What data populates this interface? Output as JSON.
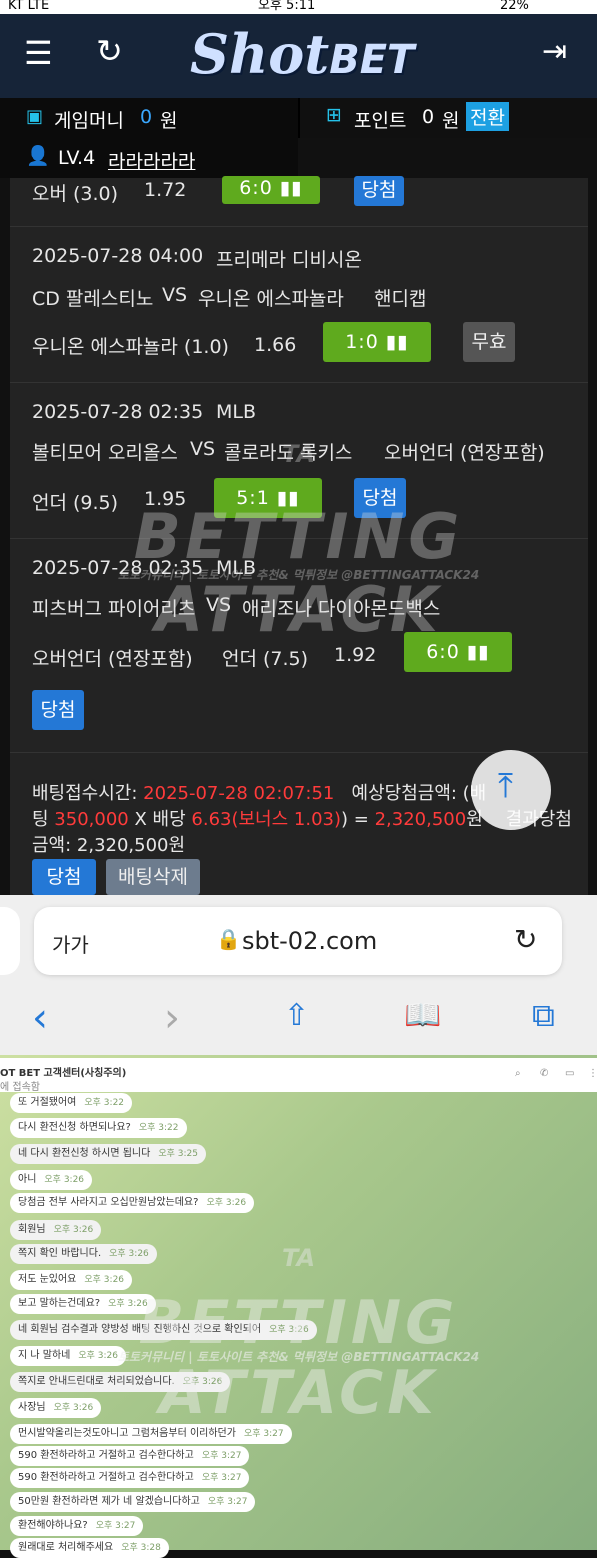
{
  "status": {
    "carrier": "KT LTE",
    "time": "오후 5:11",
    "battery": "22%"
  },
  "header": {
    "logo_script": "Shot",
    "logo_bet": "BET"
  },
  "wallet": {
    "money_label": "게임머니",
    "money_value": "0",
    "money_unit": "원",
    "point_label": "포인트",
    "point_value": "0",
    "point_unit": "원",
    "convert_label": "전환",
    "level": "LV.4",
    "nickname": "라라라라라"
  },
  "bets": {
    "partial": {
      "pick": "오버 (3.0)",
      "odds": "1.72",
      "score": "6:0",
      "result": "당첨"
    },
    "b1": {
      "datetime": "2025-07-28 04:00",
      "league": "프리메라 디비시온",
      "home": "CD 팔레스티노",
      "vs": "VS",
      "away": "우니온 에스파뇰라",
      "type": "핸디캡",
      "pick": "우니온 에스파뇰라 (1.0)",
      "odds": "1.66",
      "score": "1:0",
      "result": "무효"
    },
    "b2": {
      "datetime": "2025-07-28 02:35",
      "league": "MLB",
      "home": "볼티모어 오리올스",
      "vs": "VS",
      "away": "콜로라도 록키스",
      "type": "오버언더 (연장포함)",
      "pick": "언더 (9.5)",
      "odds": "1.95",
      "score": "5:1",
      "result": "당첨"
    },
    "b3": {
      "datetime": "2025-07-28 02:35",
      "league": "MLB",
      "home": "피츠버그 파이어리츠",
      "vs": "VS",
      "away": "애리조나 다이아몬드백스",
      "type": "오버언더 (연장포함)",
      "pick": "언더 (7.5)",
      "odds": "1.92",
      "score": "6:0",
      "result": "당첨"
    }
  },
  "summary": {
    "time_label": "배팅접수시간:",
    "time_value": "2025-07-28 02:07:51",
    "expected_label": "예상당첨금액: (배",
    "l2a": "팅",
    "stake": "350,000",
    "l2b": "X 배당",
    "odds": "6.63(보너스 1.03)",
    "l2c": ")",
    "eq": "=",
    "payout": "2,320,500",
    "unit": "원",
    "result_label": "결과당첨",
    "l3": "금액: 2,320,500원",
    "win_button": "당첨",
    "delete_button": "배팅삭제"
  },
  "browser": {
    "text_size": "가가",
    "url": "sbt-02.com"
  },
  "watermark": {
    "title": "BETTING ATTACK",
    "badge": "TA",
    "sub": "토토커뮤니티 | 토토사이트 추천& 먹튀정보 @BETTINGATTACK24"
  },
  "chat": {
    "title": "OT BET 고객센터(사칭주의)",
    "subtitle": "에 접속함",
    "messages": [
      {
        "text": "또 거절됐어여",
        "time": "오후 3:22"
      },
      {
        "text": "다시 환전신청 하면되나요?",
        "time": "오후 3:22"
      },
      {
        "text": "네 다시 환전신청 하시면 됩니다",
        "time": "오후 3:25"
      },
      {
        "text": "아니",
        "time": "오후 3:26"
      },
      {
        "text": "당첨금 전부 사라지고 오십만원남았는데요?",
        "time": "오후 3:26"
      },
      {
        "text": "회원님",
        "time": "오후 3:26"
      },
      {
        "text": "쪽지 확인 바랍니다.",
        "time": "오후 3:26"
      },
      {
        "text": "저도 눈있어요",
        "time": "오후 3:26"
      },
      {
        "text": "보고 말하는건데요?",
        "time": "오후 3:26"
      },
      {
        "text": "네 회원님 검수결과 양방성 배팅 진행하신 것으로 확인되어",
        "time": "오후 3:26"
      },
      {
        "text": "지 나 말하네",
        "time": "오후 3:26"
      },
      {
        "text": "쪽지로 안내드린대로 처리되었습니다.",
        "time": "오후 3:26"
      },
      {
        "text": "사장님",
        "time": "오후 3:26"
      },
      {
        "text": "먼시발약올리는것도아니고 그럼처음부터 이리하던가",
        "time": "오후 3:27"
      },
      {
        "text": "590 환전하라하고 거절하고 검수한다하고",
        "time": "오후 3:27"
      },
      {
        "text": "590 환전하라하고 거절하고 검수한다하고",
        "time": "오후 3:27"
      },
      {
        "text": "50만원 환전하라면 제가 네 알겠습니다하고",
        "time": "오후 3:27"
      },
      {
        "text": "환전해야하나요?",
        "time": "오후 3:27"
      },
      {
        "text": "원래대로 처리해주세요",
        "time": "오후 3:28"
      }
    ]
  }
}
